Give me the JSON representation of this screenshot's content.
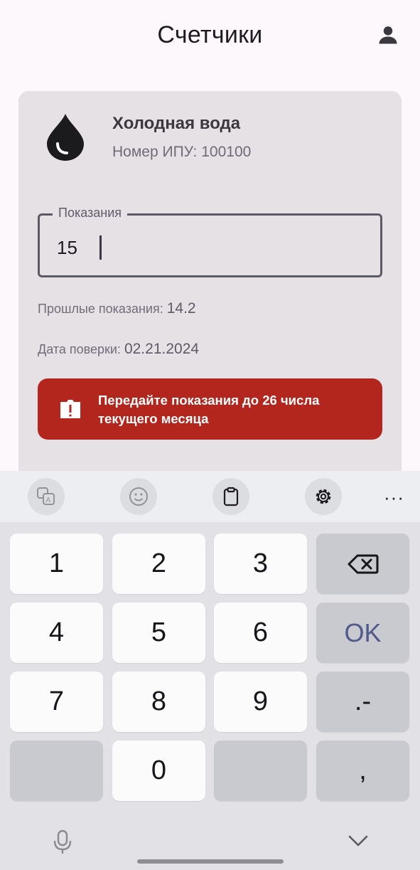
{
  "appbar": {
    "title": "Счетчики",
    "account_icon": "account-circle-icon"
  },
  "meter": {
    "icon": "water-drop-icon",
    "name": "Холодная вода",
    "number_label": "Номер ИПУ:",
    "number_value": "100100",
    "reading_label": "Показания",
    "reading_value": "15",
    "prev_label": "Прошлые показания:",
    "prev_value": "14.2",
    "verify_label": "Дата поверки:",
    "verify_value": "02.21.2024",
    "alert_icon": "report-icon",
    "alert_text_line1": "Передайте показания до 26 числа",
    "alert_text_line2": "текущего месяца",
    "alert_color": "#b3261e"
  },
  "keyboard": {
    "toolbar": [
      "translate-icon",
      "emoji-icon",
      "clipboard-icon",
      "settings-icon"
    ],
    "more_label": "···",
    "rows": [
      [
        "1",
        "2",
        "3",
        "backspace"
      ],
      [
        "4",
        "5",
        "6",
        "OK"
      ],
      [
        "7",
        "8",
        "9",
        ".-"
      ],
      [
        "",
        "0",
        "",
        ","
      ]
    ],
    "key_labels": {
      "k1": "1",
      "k2": "2",
      "k3": "3",
      "k4": "4",
      "k5": "5",
      "k6": "6",
      "k7": "7",
      "k8": "8",
      "k9": "9",
      "k0": "0",
      "ok": "OK",
      "dot_minus": ".-",
      "comma": ","
    }
  }
}
